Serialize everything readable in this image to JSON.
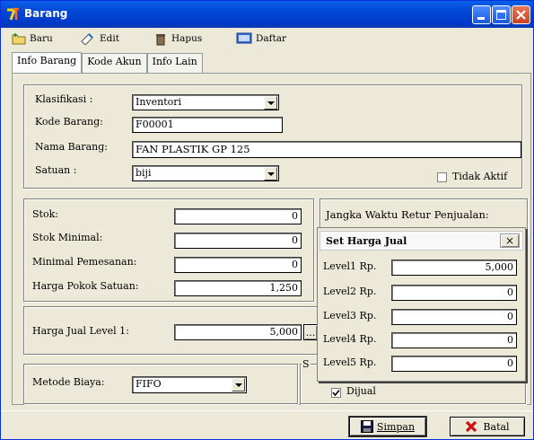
{
  "window": {
    "title": "Barang"
  },
  "toolbar": {
    "baru": "Baru",
    "edit": "Edit",
    "hapus": "Hapus",
    "daftar": "Daftar"
  },
  "tabs": [
    "Info Barang",
    "Kode Akun",
    "Info Lain"
  ],
  "info": {
    "klasifikasi_label": "Klasifikasi :",
    "klasifikasi_value": "Inventori",
    "kode_label": "Kode Barang:",
    "kode_value": "F00001",
    "nama_label": "Nama Barang:",
    "nama_value": "FAN PLASTIK GP 125",
    "satuan_label": "Satuan :",
    "satuan_value": "biji",
    "tidak_aktif": "Tidak Aktif"
  },
  "stok": {
    "stok_label": "Stok:",
    "stok_value": "0",
    "min_label": "Stok Minimal:",
    "min_value": "0",
    "pesan_label": "Minimal Pemesanan:",
    "pesan_value": "0",
    "hpp_label": "Harga Pokok Satuan:",
    "hpp_value": "1,250"
  },
  "retur_label": "Jangka Waktu Retur Penjualan:",
  "harga": {
    "label": "Harga Jual Level 1:",
    "value": "5,000",
    "more": "..."
  },
  "metode": {
    "label": "Metode Biaya:",
    "value": "FIFO"
  },
  "s_label": "S",
  "dijual": "Dijual",
  "popup": {
    "title": "Set Harga Jual",
    "close": "×",
    "levels": [
      {
        "label": "Level1 Rp.",
        "value": "5,000"
      },
      {
        "label": "Level2 Rp.",
        "value": "0"
      },
      {
        "label": "Level3 Rp.",
        "value": "0"
      },
      {
        "label": "Level4 Rp.",
        "value": "0"
      },
      {
        "label": "Level5 Rp.",
        "value": "0"
      }
    ]
  },
  "buttons": {
    "simpan": "Simpan",
    "batal": "Batal"
  }
}
